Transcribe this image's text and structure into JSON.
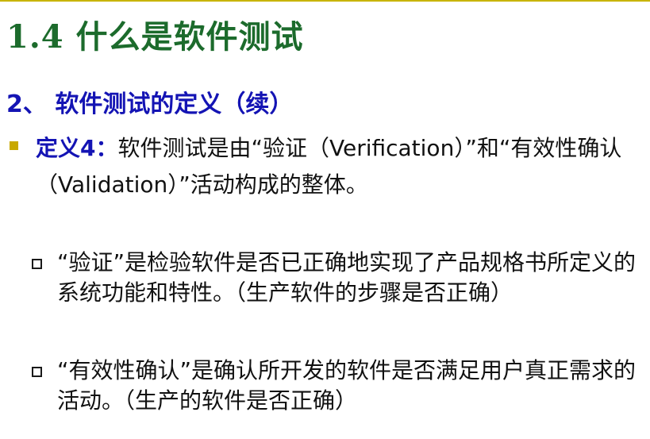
{
  "slide": {
    "title": "1.4 什么是软件测试",
    "subtitle": "2、 软件测试的定义（续）",
    "bullet": {
      "lead": "定义4：",
      "text": "软件测试是由“验证（Verification）”和“有效性确认（Validation）”活动构成的整体。"
    },
    "sub_bullets": [
      {
        "text": "“验证”是检验软件是否已正确地实现了产品规格书所定义的系统功能和特性。（生产软件的步骤是否正确）"
      },
      {
        "text": "“有效性确认”是确认所开发的软件是否满足用户真正需求的活动。（生产的软件是否正确）"
      }
    ],
    "colors": {
      "title": "#1c6b2c",
      "subtitle": "#1414b4",
      "bullet_marker": "#c8a800",
      "body_text": "#111111"
    }
  }
}
